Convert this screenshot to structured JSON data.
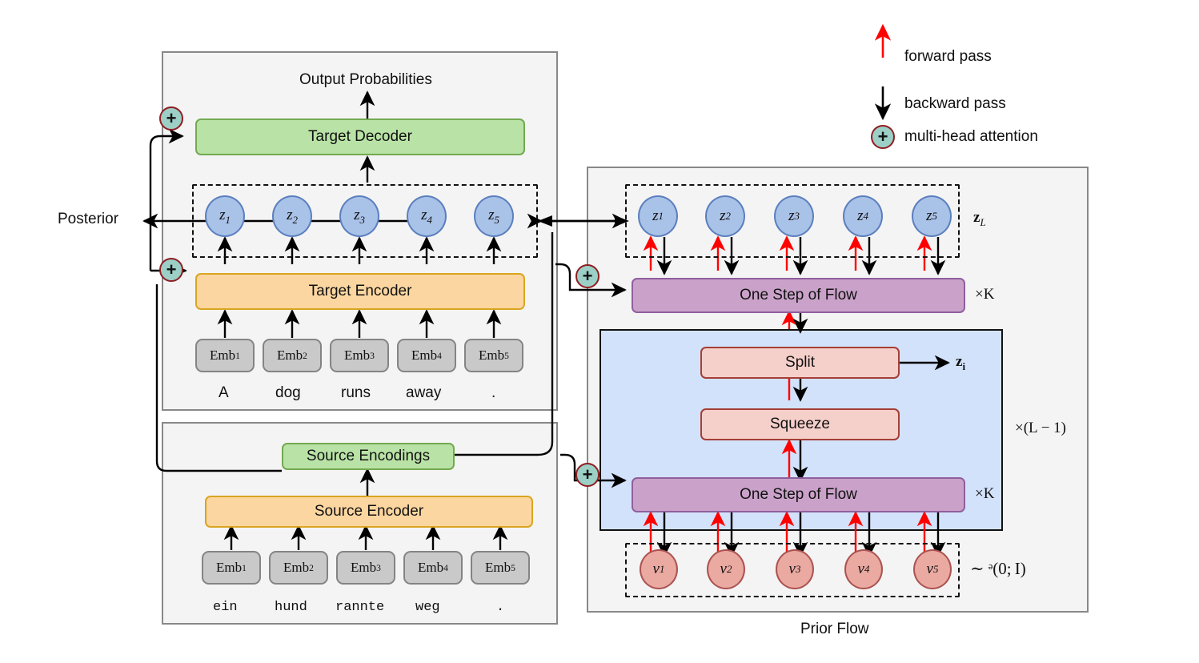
{
  "legend": {
    "items": [
      {
        "id": "forward",
        "label": "forward pass",
        "color": "#ff0000"
      },
      {
        "id": "backward",
        "label": "backward pass",
        "color": "#000000"
      },
      {
        "id": "attention",
        "label": "multi-head attention",
        "glyph": "+",
        "color": "#9ccfc6"
      }
    ]
  },
  "posterior": {
    "label": "Posterior"
  },
  "target_panel": {
    "output_label": "Output Probabilities",
    "decoder_label": "Target Decoder",
    "encoder_label": "Target Encoder",
    "latents": [
      "z1",
      "z2",
      "z3",
      "z4",
      "z5"
    ],
    "embeddings": [
      "Emb1",
      "Emb2",
      "Emb3",
      "Emb4",
      "Emb5"
    ],
    "tokens": [
      "A",
      "dog",
      "runs",
      "away",
      "."
    ]
  },
  "source_panel": {
    "encodings_label": "Source Encodings",
    "encoder_label": "Source Encoder",
    "embeddings": [
      "Emb1",
      "Emb2",
      "Emb3",
      "Emb4",
      "Emb5"
    ],
    "tokens": [
      "ein",
      "hund",
      "rannte",
      "weg",
      "."
    ]
  },
  "prior_panel": {
    "title": "Prior Flow",
    "latents": [
      "z1",
      "z2",
      "z3",
      "z4",
      "z5"
    ],
    "latents_group_label": "z_L",
    "flow_top_label": "One Step of Flow",
    "flow_top_repeat": "×K",
    "split_label": "Split",
    "split_output_label": "z_i",
    "squeeze_label": "Squeeze",
    "flow_bottom_label": "One Step of Flow",
    "flow_bottom_repeat": "×K",
    "level_repeat": "×(L − 1)",
    "noise_vars": [
      "v1",
      "v2",
      "v3",
      "v4",
      "v5"
    ],
    "noise_dist": "∼ ᵊ(0; I)"
  },
  "colors": {
    "forward": "#ff0000",
    "backward": "#000000",
    "green": "#b9e3a6",
    "orange": "#fcd6a0",
    "purple": "#caa2c9",
    "pink": "#f5cfca",
    "latent_blue": "#a9c2e8",
    "noise_red": "#eaa9a1",
    "flow_bg": "#d3e2fb",
    "panel_bg": "#f4f4f4",
    "attention": "#9ccfc6"
  }
}
